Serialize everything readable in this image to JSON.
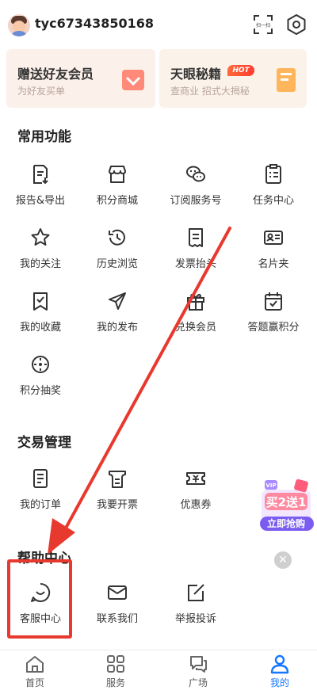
{
  "header": {
    "username": "tyc67343850168",
    "scan_label": "扫一扫"
  },
  "promos": [
    {
      "title": "赠送好友会员",
      "subtitle": "为好友买单"
    },
    {
      "title": "天眼秘籍",
      "badge": "HOT",
      "subtitle": "查商业 招式大揭秘"
    }
  ],
  "common": {
    "title": "常用功能",
    "items": [
      {
        "label": "报告&导出",
        "icon": "report-export-icon"
      },
      {
        "label": "积分商城",
        "icon": "store-icon"
      },
      {
        "label": "订阅服务号",
        "icon": "wechat-icon"
      },
      {
        "label": "任务中心",
        "icon": "task-list-icon"
      },
      {
        "label": "我的关注",
        "icon": "star-icon"
      },
      {
        "label": "历史浏览",
        "icon": "history-icon"
      },
      {
        "label": "发票抬头",
        "icon": "invoice-icon"
      },
      {
        "label": "名片夹",
        "icon": "card-holder-icon"
      },
      {
        "label": "我的收藏",
        "icon": "bookmark-icon"
      },
      {
        "label": "我的发布",
        "icon": "send-icon"
      },
      {
        "label": "兑换会员",
        "icon": "gift-icon"
      },
      {
        "label": "答题赢积分",
        "icon": "quiz-icon"
      },
      {
        "label": "积分抽奖",
        "icon": "lottery-icon"
      }
    ]
  },
  "trade": {
    "title": "交易管理",
    "items": [
      {
        "label": "我的订单",
        "icon": "order-icon"
      },
      {
        "label": "我要开票",
        "icon": "invoice-issue-icon"
      },
      {
        "label": "优惠券",
        "icon": "coupon-icon"
      }
    ]
  },
  "help": {
    "title": "帮助中心",
    "items": [
      {
        "label": "客服中心",
        "icon": "customer-service-icon"
      },
      {
        "label": "联系我们",
        "icon": "mail-icon"
      },
      {
        "label": "举报投诉",
        "icon": "report-edit-icon"
      }
    ]
  },
  "float_ad": {
    "tag": "VIP",
    "line1": "买2送1",
    "line2": "立即抢购"
  },
  "tabs": [
    {
      "label": "首页",
      "icon": "home-icon"
    },
    {
      "label": "服务",
      "icon": "grid-icon"
    },
    {
      "label": "广场",
      "icon": "chat-icon"
    },
    {
      "label": "我的",
      "icon": "user-icon",
      "active": true
    }
  ],
  "colors": {
    "accent": "#1677ff",
    "highlight": "#e8392f",
    "icon": "#333333"
  }
}
